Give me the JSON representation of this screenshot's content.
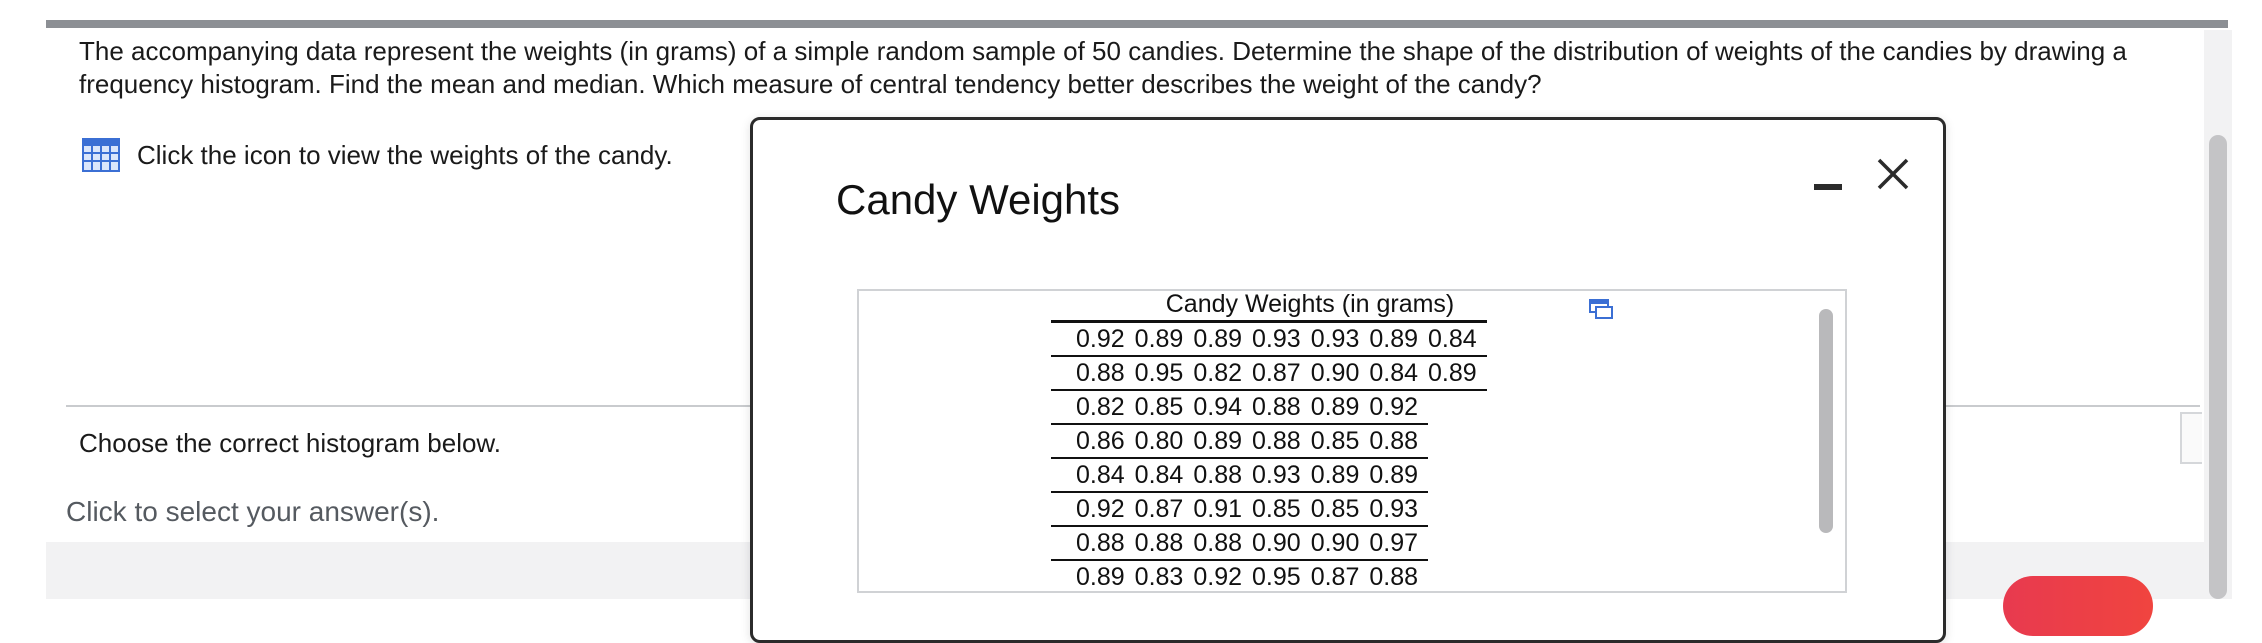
{
  "question": {
    "text": "The accompanying data represent the weights (in grams) of a simple random sample of 50 candies. Determine the shape of the distribution of weights of the candies by drawing a frequency histogram. Find the mean and median. Which measure of central tendency better describes the weight of the candy?"
  },
  "data_link": {
    "icon": "grid-table-icon",
    "label": "Click the icon to view the weights of the candy."
  },
  "answer": {
    "choose_label": "Choose the correct histogram below.",
    "select_hint": "Click to select your answer(s)."
  },
  "modal": {
    "title": "Candy Weights",
    "table_caption": "Candy Weights (in grams)",
    "rows": [
      [
        "0.92",
        "0.89",
        "0.89",
        "0.93",
        "0.93",
        "0.89",
        "0.84"
      ],
      [
        "0.88",
        "0.95",
        "0.82",
        "0.87",
        "0.90",
        "0.84",
        "0.89"
      ],
      [
        "0.82",
        "0.85",
        "0.94",
        "0.88",
        "0.89",
        "0.92",
        ""
      ],
      [
        "0.86",
        "0.80",
        "0.89",
        "0.88",
        "0.85",
        "0.88",
        ""
      ],
      [
        "0.84",
        "0.84",
        "0.88",
        "0.93",
        "0.89",
        "0.89",
        ""
      ],
      [
        "0.92",
        "0.87",
        "0.91",
        "0.85",
        "0.85",
        "0.93",
        ""
      ],
      [
        "0.88",
        "0.88",
        "0.88",
        "0.90",
        "0.90",
        "0.97",
        ""
      ],
      [
        "0.89",
        "0.83",
        "0.92",
        "0.95",
        "0.87",
        "0.88",
        ""
      ]
    ]
  },
  "colors": {
    "accent_red": "#e83a4f",
    "icon_blue": "#3b6fd4"
  }
}
